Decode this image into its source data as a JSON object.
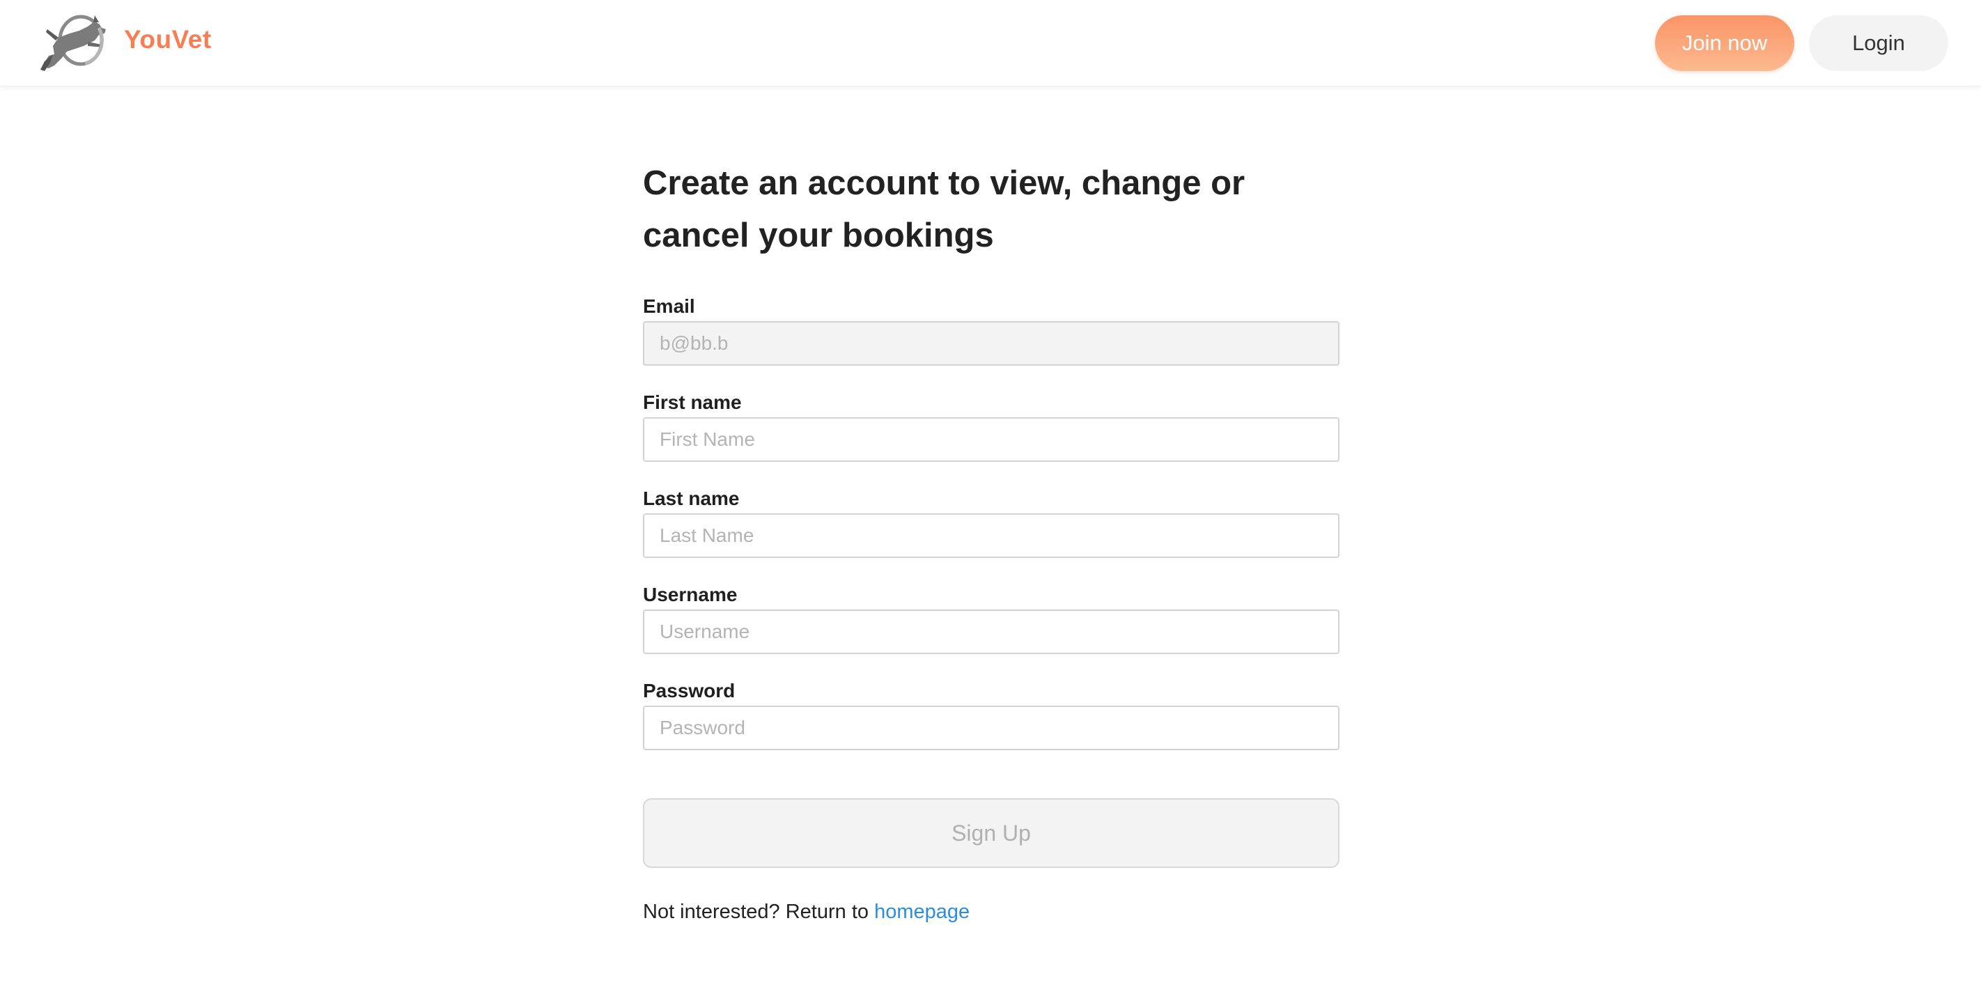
{
  "header": {
    "brand": "YouVet",
    "join_label": "Join now",
    "login_label": "Login",
    "logo_icon": "dog-jumping-through-hoop-logo",
    "brand_color": "#f47f55"
  },
  "form": {
    "heading": "Create an account to view, change or cancel your bookings",
    "email": {
      "label": "Email",
      "value": "b@bb.b",
      "disabled": true
    },
    "first_name": {
      "label": "First name",
      "placeholder": "First Name"
    },
    "last_name": {
      "label": "Last name",
      "placeholder": "Last Name"
    },
    "username": {
      "label": "Username",
      "placeholder": "Username"
    },
    "password": {
      "label": "Password",
      "placeholder": "Password"
    },
    "submit_label": "Sign Up",
    "footer_text": "Not interested? Return to ",
    "footer_link": "homepage",
    "link_color": "#2a8de0"
  }
}
